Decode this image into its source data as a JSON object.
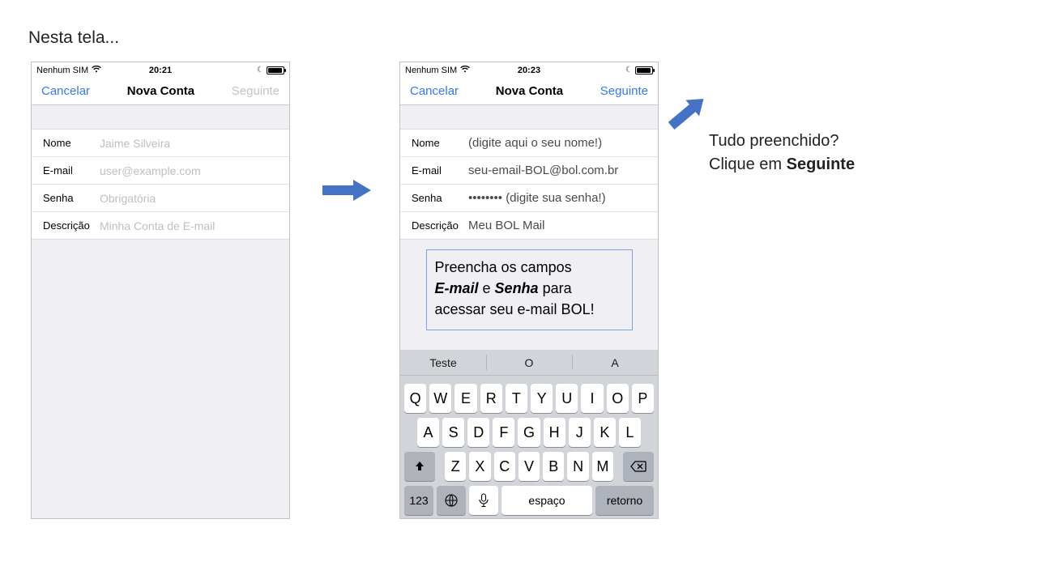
{
  "page_title": "Nesta tela...",
  "phone_left": {
    "status": {
      "sim": "Nenhum SIM",
      "wifi_icon": "wifi-icon",
      "time": "20:21"
    },
    "nav": {
      "left": "Cancelar",
      "title": "Nova Conta",
      "right": "Seguinte",
      "right_disabled": true
    },
    "rows": {
      "nome": {
        "label": "Nome",
        "value": "Jaime Silveira",
        "placeholder": true
      },
      "email": {
        "label": "E-mail",
        "value": "user@example.com",
        "placeholder": true
      },
      "senha": {
        "label": "Senha",
        "value": "Obrigatória",
        "placeholder": true
      },
      "descricao": {
        "label": "Descrição",
        "value": "Minha Conta de E-mail",
        "placeholder": true
      }
    }
  },
  "phone_right": {
    "status": {
      "sim": "Nenhum SIM",
      "wifi_icon": "wifi-icon",
      "time": "20:23"
    },
    "nav": {
      "left": "Cancelar",
      "title": "Nova Conta",
      "right": "Seguinte",
      "right_disabled": false
    },
    "rows": {
      "nome": {
        "label": "Nome",
        "value": "(digite aqui o seu nome!)"
      },
      "email": {
        "label": "E-mail",
        "value": "seu-email-BOL@bol.com.br"
      },
      "senha": {
        "label": "Senha",
        "dots": "••••••••",
        "hint": "(digite sua senha!)"
      },
      "descricao": {
        "label": "Descrição",
        "value": "Meu BOL Mail"
      }
    },
    "callout": {
      "p1": "Preencha os campos",
      "bi1": "E-mail",
      "mid": " e ",
      "bi2": "Senha",
      "p2": " para",
      "p3": "acessar seu e-mail BOL!"
    },
    "keyboard": {
      "pred": [
        "Teste",
        "O",
        "A"
      ],
      "row1": [
        "Q",
        "W",
        "E",
        "R",
        "T",
        "Y",
        "U",
        "I",
        "O",
        "P"
      ],
      "row2": [
        "A",
        "S",
        "D",
        "F",
        "G",
        "H",
        "J",
        "K",
        "L"
      ],
      "row3": [
        "Z",
        "X",
        "C",
        "V",
        "B",
        "N",
        "M"
      ],
      "k123": "123",
      "space": "espaço",
      "ret": "retorno"
    }
  },
  "cta": {
    "line1": "Tudo preenchido?",
    "line2a": "Clique em ",
    "line2b": "Seguinte"
  }
}
